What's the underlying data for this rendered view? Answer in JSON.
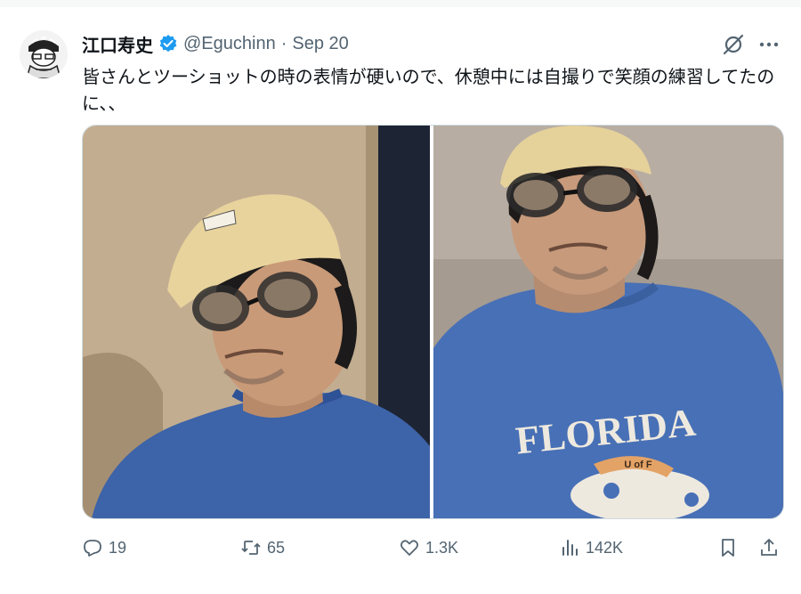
{
  "tweet": {
    "display_name": "江口寿史",
    "handle": "@Eguchinn",
    "separator": "·",
    "date": "Sep 20",
    "text": "皆さんとツーショットの時の表情が硬いので、休憩中には自撮りで笑顔の練習してたのに、、"
  },
  "media": {
    "photo_1": {
      "shirt_text": ""
    },
    "photo_2": {
      "shirt_text": "FLORIDA",
      "cap_text": "U of F"
    }
  },
  "actions": {
    "replies": "19",
    "reposts": "65",
    "likes": "1.3K",
    "views": "142K"
  },
  "colors": {
    "accent": "#1d9bf0",
    "muted": "#536471",
    "text": "#0f1419"
  },
  "icons": [
    "grok-icon",
    "more-icon",
    "reply-icon",
    "retweet-icon",
    "heart-icon",
    "views-icon",
    "bookmark-icon",
    "share-icon",
    "verified-badge-icon"
  ]
}
